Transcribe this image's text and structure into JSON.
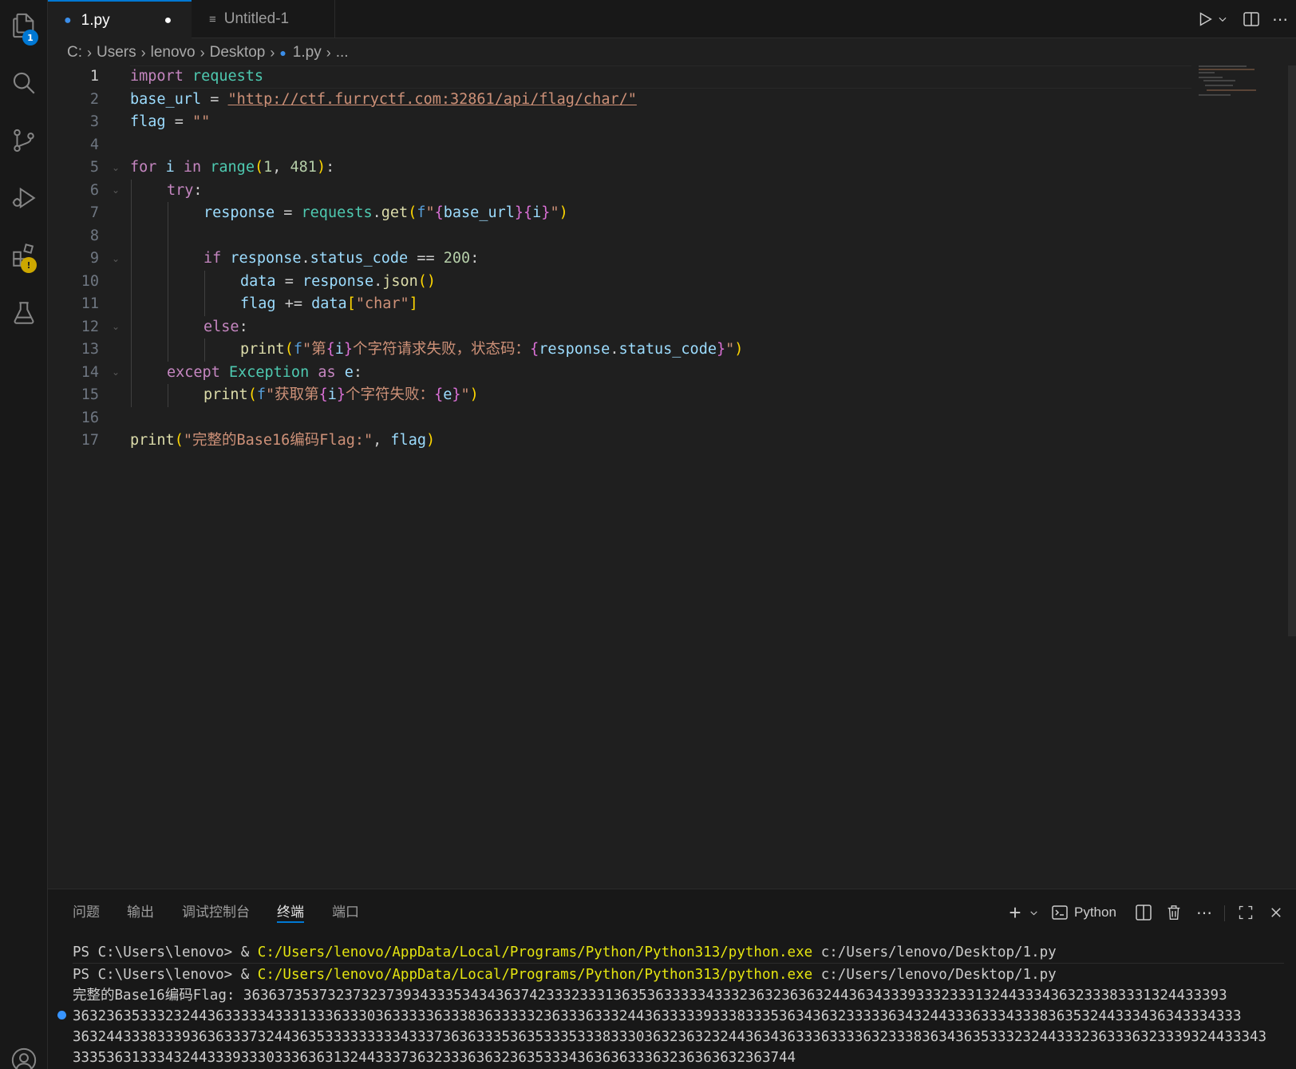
{
  "activity_bar": {
    "explorer_badge": "1",
    "extensions_badge": "!"
  },
  "tabs": [
    {
      "label": "1.py",
      "modified_dot": "●"
    },
    {
      "label": "Untitled-1"
    }
  ],
  "breadcrumb": [
    "C:",
    "Users",
    "lenovo",
    "Desktop",
    "1.py",
    "..."
  ],
  "line_numbers": [
    "1",
    "2",
    "3",
    "4",
    "5",
    "6",
    "7",
    "8",
    "9",
    "10",
    "11",
    "12",
    "13",
    "14",
    "15",
    "16",
    "17"
  ],
  "code": {
    "l1": [
      "import",
      " ",
      "requests"
    ],
    "l2": [
      "base_url",
      " = ",
      "\"http://ctf.furryctf.com:32861/api/flag/char/\""
    ],
    "l3": [
      "flag",
      " = ",
      "\"\""
    ],
    "l5": [
      "for",
      " ",
      "i",
      " ",
      "in",
      " ",
      "range",
      "(",
      "1",
      ", ",
      "481",
      ")",
      ":"
    ],
    "l6": [
      "try",
      ":"
    ],
    "l7": [
      "response",
      " = ",
      "requests",
      ".",
      "get",
      "(",
      "f",
      "\"",
      "{",
      "base_url",
      "}",
      "{",
      "i",
      "}",
      "\"",
      ")"
    ],
    "l9": [
      "if",
      " ",
      "response",
      ".",
      "status_code",
      " == ",
      "200",
      ":"
    ],
    "l10": [
      "data",
      " = ",
      "response",
      ".",
      "json",
      "()"
    ],
    "l11": [
      "flag",
      " += ",
      "data",
      "[",
      "\"char\"",
      "]"
    ],
    "l12": [
      "else",
      ":"
    ],
    "l13": [
      "print",
      "(",
      "f",
      "\"第",
      "{",
      "i",
      "}",
      "个字符请求失败，状态码：",
      "{",
      "response",
      ".",
      "status_code",
      "}",
      "\"",
      ")"
    ],
    "l14": [
      "except",
      " ",
      "Exception",
      " ",
      "as",
      " ",
      "e",
      ":"
    ],
    "l15": [
      "print",
      "(",
      "f",
      "\"获取第",
      "{",
      "i",
      "}",
      "个字符失败：",
      "{",
      "e",
      "}",
      "\"",
      ")"
    ],
    "l17": [
      "print",
      "(",
      "\"完整的Base16编码Flag:\"",
      ", ",
      "flag",
      ")"
    ]
  },
  "panel": {
    "tabs": [
      "问题",
      "输出",
      "调试控制台",
      "终端",
      "端口"
    ],
    "active_tab": "终端",
    "shell_label": "Python"
  },
  "terminal": {
    "prompt": "PS C:\\Users\\lenovo> ",
    "amp": "& ",
    "exe": "C:/Users/lenovo/AppData/Local/Programs/Python/Python313/python.exe",
    "script": " c:/Users/lenovo/Desktop/1.py",
    "output_lines": [
      "完整的Base16编码Flag: 363637353732373237393433353434363742333233313635363333343332363236363244363433393332333132443334363233383331324433393",
      "3632363533323244363333343331333633303633333633383633333236333633324436333339333833353634363233333634324433363334333836353244333436343334333",
      "3632443338333936363337324436353333333334333736363335363533353338333036323632324436343633363333632333836343635333232443332363336323339324433343",
      "33353631333432443339333033363631324433373632333636323635333436363633363236363632363744"
    ]
  },
  "colors": {
    "accent": "#0078d4",
    "editor_bg": "#1f1f1f",
    "sidebar_bg": "#181818"
  }
}
